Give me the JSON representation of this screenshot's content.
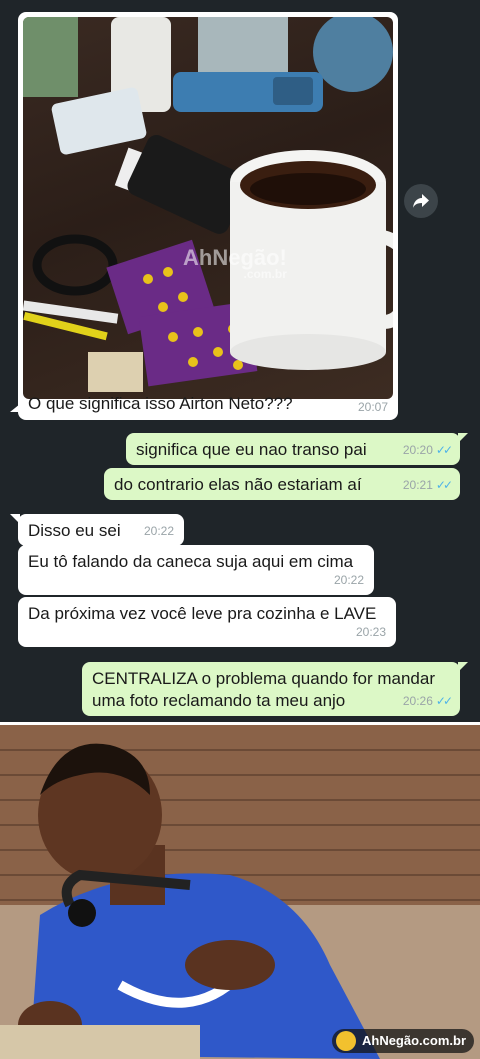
{
  "image_message": {
    "caption": "O que significa isso Airton Neto???",
    "time": "20:07",
    "photo_watermark": "AhNegão!",
    "photo_watermark_sub": ".com.br"
  },
  "messages": [
    {
      "text": "significa que eu nao transo pai",
      "time": "20:20"
    },
    {
      "text": "do contrario elas não estariam aí",
      "time": "20:21"
    },
    {
      "text": "Disso eu sei",
      "time": "20:22"
    },
    {
      "text": "Eu tô falando da caneca suja aqui em cima",
      "time": "20:22"
    },
    {
      "text": "Da próxima vez você leve pra cozinha e LAVE",
      "time": "20:23"
    },
    {
      "line1": "CENTRALIZA o problema quando for mandar",
      "line2": "uma foto reclamando ta meu anjo",
      "time": "20:26"
    }
  ],
  "ticks": "✓✓",
  "colors": {
    "incoming": "#ffffff",
    "outgoing": "#dcf8c6",
    "background": "#1f2529",
    "tick": "#4fb3e8"
  },
  "brand_watermark": "AhNegão.com.br"
}
